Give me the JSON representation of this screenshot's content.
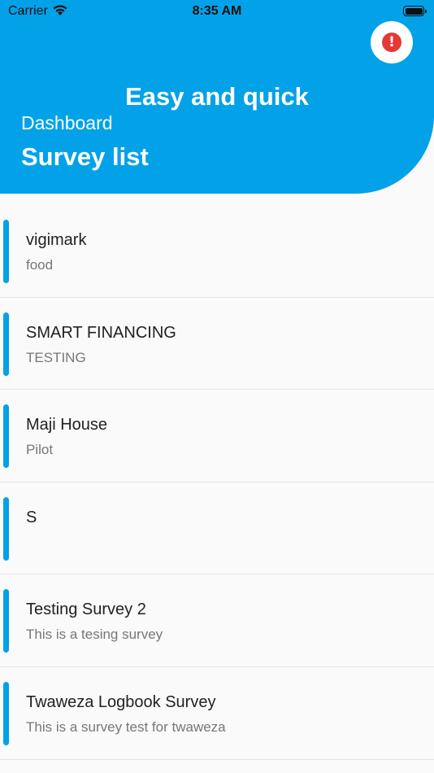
{
  "status_bar": {
    "carrier": "Carrier",
    "time": "8:35 AM"
  },
  "header": {
    "tagline": "Easy and quick",
    "subtitle": "Dashboard",
    "title": "Survey list",
    "alert_icon": "!",
    "background_color": "#03a2e8",
    "alert_color": "#e53935"
  },
  "surveys": [
    {
      "name": "vigimark",
      "description": "food"
    },
    {
      "name": "SMART FINANCING",
      "description": "TESTING"
    },
    {
      "name": "Maji House",
      "description": "Pilot"
    },
    {
      "name": "S",
      "description": ""
    },
    {
      "name": "Testing Survey 2",
      "description": "This is a tesing survey"
    },
    {
      "name": "Twaweza Logbook Survey",
      "description": "This is a survey test for twaweza"
    }
  ]
}
